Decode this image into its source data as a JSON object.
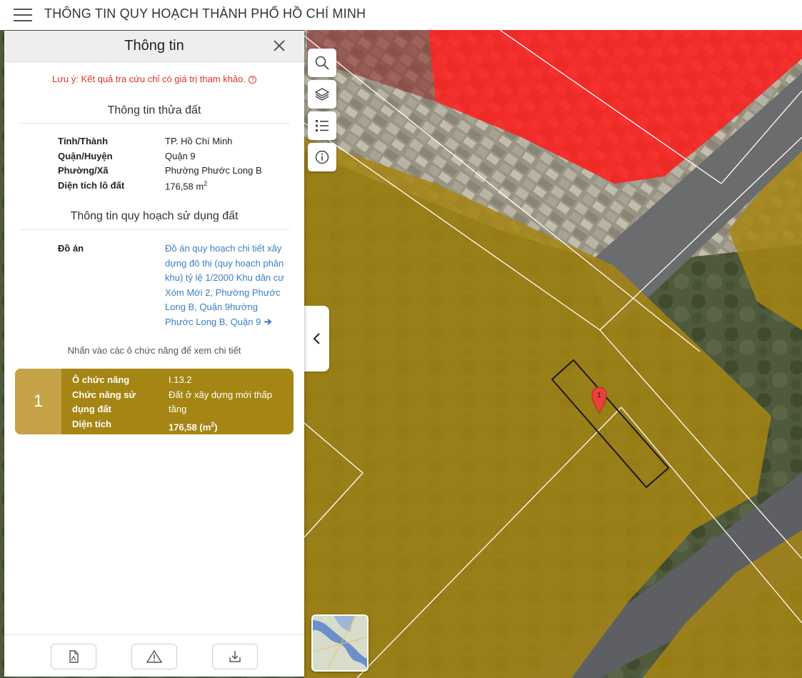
{
  "app": {
    "title": "THÔNG TIN QUY HOẠCH THÀNH PHỐ HỒ CHÍ MINH"
  },
  "panel": {
    "title": "Thông tin",
    "note": "Lưu ý: Kết quả tra cứu chỉ có giá trị tham khảo.",
    "note_icon": "?",
    "parcel_section_title": "Thông tin thửa đất",
    "parcel": [
      {
        "label": "Tỉnh/Thành",
        "value": "TP. Hồ Chí Minh"
      },
      {
        "label": "Quận/Huyện",
        "value": "Quận 9"
      },
      {
        "label": "Phường/Xã",
        "value": "Phường Phước Long B"
      },
      {
        "label": "Diện tích lô đất",
        "value": "176,58 m",
        "value_sup": "2"
      }
    ],
    "planning_section_title": "Thông tin quy hoạch sử dụng đất",
    "project_label": "Đồ án",
    "project_link": "Đồ án quy hoạch chi tiết xây dựng đô thị (quy hoạch phân khu) tỷ lệ 1/2000 Khu dân cư Xóm Mới 2, Phường Phước Long B, Quận 9hường Phước Long B, Quận 9",
    "hint": "Nhấn vào các ô chức năng để xem chi tiết",
    "zones": [
      {
        "number": "1",
        "code_label": "Ô chức năng",
        "code_value": "I.13.2",
        "function_label": "Chức năng sử dụng đất",
        "function_value": "Đất ở xây dựng mới thấp tầng",
        "area_label": "Diện tích",
        "area_value_prefix": "176,58 (m",
        "area_value_sup": "2",
        "area_value_suffix": ")",
        "color": "#a58513"
      }
    ],
    "footer_buttons": [
      "document-icon",
      "warning-icon",
      "download-icon"
    ]
  },
  "map": {
    "controls": [
      "search-icon",
      "layers-icon",
      "legend-list-icon",
      "info-icon"
    ],
    "collapse_icon": "chevron-left-icon",
    "marker_label": "1",
    "colors": {
      "zone_residential": "#a58513",
      "zone_red": "#ff1a1a",
      "boundary": "#ffffff",
      "selected_parcel": "#1a1a1a"
    }
  }
}
